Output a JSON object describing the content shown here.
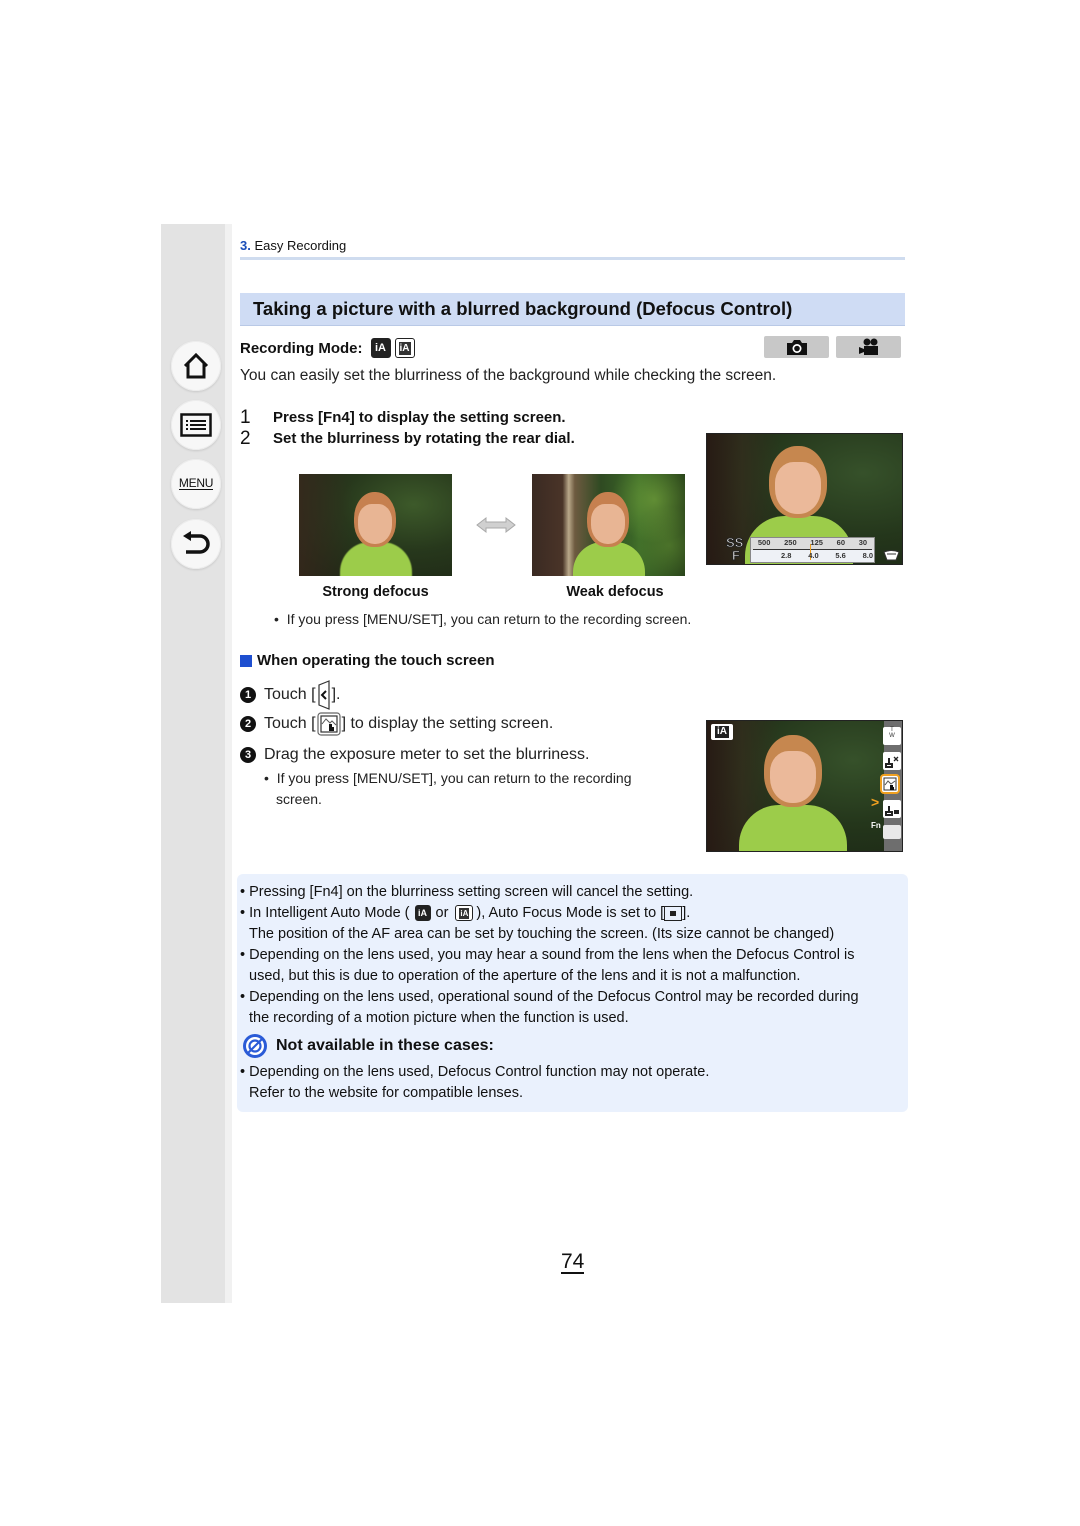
{
  "sidebar": {
    "items": [
      {
        "name": "home",
        "label": ""
      },
      {
        "name": "contents",
        "label": ""
      },
      {
        "name": "menu",
        "label": "MENU"
      },
      {
        "name": "back",
        "label": ""
      }
    ]
  },
  "breadcrumb": {
    "number": "3.",
    "label": "Easy Recording"
  },
  "section": {
    "title": "Taking a picture with a blurred background (Defocus Control)"
  },
  "recording_mode": {
    "label": "Recording Mode:",
    "modes": [
      "iA",
      "iA+"
    ],
    "capture_types": [
      "photo",
      "video"
    ]
  },
  "intro": "You can easily set the blurriness of the background while checking the screen.",
  "steps": [
    {
      "num": "1",
      "text": "Press [Fn4] to display the setting screen."
    },
    {
      "num": "2",
      "text": "Set the blurriness by rotating the rear dial."
    }
  ],
  "comparison": {
    "left_caption": "Strong defocus",
    "right_caption": "Weak defocus"
  },
  "camera_screen": {
    "ss_label": "SS",
    "f_label": "F",
    "shutter_values": [
      "500",
      "250",
      "125",
      "60",
      "30"
    ],
    "aperture_values": [
      "2.8",
      "4.0",
      "5.6",
      "8.0"
    ]
  },
  "step_note": "If you press [MENU/SET], you can return to the recording screen.",
  "touch": {
    "heading": "When operating the touch screen",
    "steps": [
      {
        "num": "1",
        "text_before": "Touch [",
        "text_after": "]."
      },
      {
        "num": "2",
        "text_before": "Touch [",
        "text_after": "] to display the setting screen."
      },
      {
        "num": "3",
        "text": "Drag the exposure meter to set the blurriness."
      }
    ],
    "note_line1": "If you press [MENU/SET], you can return to the recording",
    "note_line2": "screen.",
    "screen": {
      "mode": "iA",
      "fn_label": "Fn"
    }
  },
  "notes": {
    "items": [
      "Pressing [Fn4] on the blurriness setting screen will cancel the setting.",
      "In Intelligent Auto Mode (",
      "or",
      "), Auto Focus Mode is set to [",
      "].",
      "The position of the AF area can be set by touching the screen. (Its size cannot be changed)",
      "Depending on the lens used, you may hear a sound from the lens when the Defocus Control is",
      "used, but this is due to operation of the aperture of the lens and it is not a malfunction.",
      "Depending on the lens used, operational sound of the Defocus Control may be recorded during",
      "the recording of a motion picture when the function is used."
    ],
    "not_available_title": "Not available in these cases:",
    "not_available_items": [
      "Depending on the lens used, Defocus Control function may not operate.",
      "Refer to the website for compatible lenses."
    ]
  },
  "page_number": "74",
  "colors": {
    "accent_blue": "#1e4fd0",
    "section_bg": "#cfdcf4",
    "info_bg": "#eaf1fd",
    "highlight_orange": "#f0a020"
  }
}
